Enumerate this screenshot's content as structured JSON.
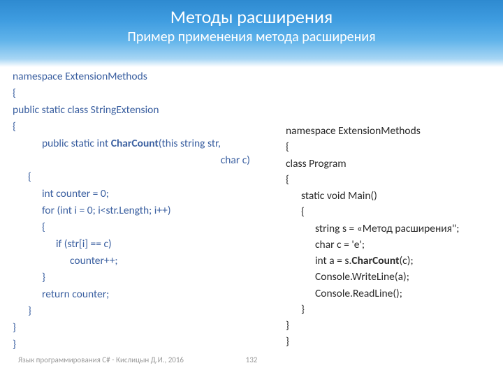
{
  "header": {
    "title": "Методы расширения",
    "subtitle": "Пример применения метода расширения"
  },
  "left": {
    "l1": "namespace  ExtensionMethods",
    "l2": "{",
    "l3": "public static class StringExtension",
    "l4": "{",
    "l5a": "public static int ",
    "l5b": "CharCount",
    "l5c": "(this string str,",
    "l6": "char c)",
    "l7": "{",
    "l8": "int counter = 0;",
    "l9": "for (int i = 0; i<str.Length; i++)",
    "l10": "{",
    "l11": "if (str[i] == c)",
    "l12": "counter++;",
    "l13": "}",
    "l14": "return counter;",
    "l15": "}",
    "l16": "}",
    "l17": "}"
  },
  "right": {
    "r1": "namespace  ExtensionMethods",
    "r2": "{",
    "r3": "class Program",
    "r4": "{",
    "r5": "static void Main()",
    "r6": "{",
    "r7": "string s = «Метод  расширения\";",
    "r8": "char c = 'е';",
    "r9a": "int a = s.",
    "r9b": "CharCount",
    "r9c": "(c);",
    "r10": "Console.WriteLine(a);",
    "r11": " ",
    "r12": "Console.ReadLine();",
    "r13": "}",
    "r14": "}",
    "r15": "}"
  },
  "footer": {
    "text": "Язык программирования C# - Кислицын Д.И., 2016",
    "page": "132"
  }
}
